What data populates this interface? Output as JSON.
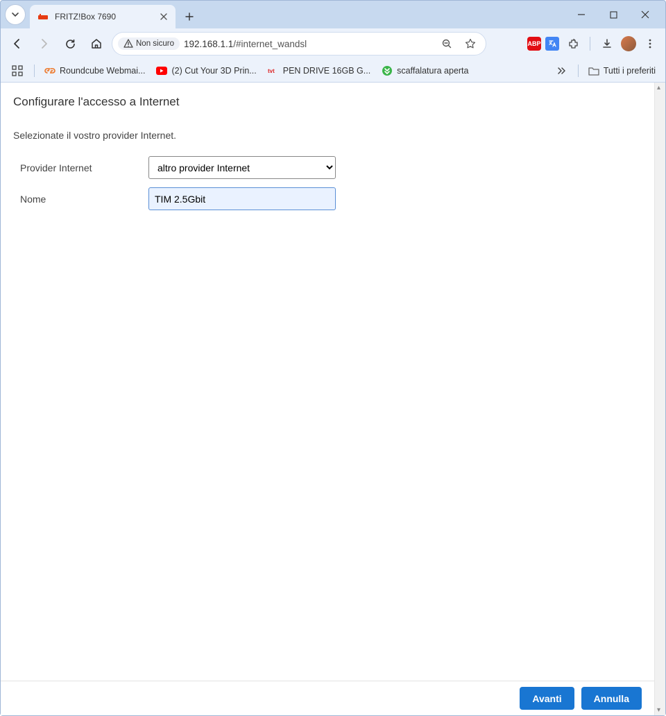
{
  "window": {
    "tab_title": "FRITZ!Box 7690"
  },
  "addressbar": {
    "security_label": "Non sicuro",
    "url_host": "192.168.1.1",
    "url_path": "/#internet_wandsl"
  },
  "bookmarks": {
    "items": [
      {
        "label": "Roundcube Webmai..."
      },
      {
        "label": "(2) Cut Your 3D Prin..."
      },
      {
        "label": "PEN DRIVE 16GB G..."
      },
      {
        "label": "scaffalatura aperta"
      }
    ],
    "all_label": "Tutti i preferiti"
  },
  "page": {
    "title": "Configurare l'accesso a Internet",
    "instruction": "Selezionate il vostro provider Internet.",
    "provider_label": "Provider Internet",
    "provider_value": "altro provider Internet",
    "name_label": "Nome",
    "name_value": "TIM 2.5Gbit"
  },
  "footer": {
    "next": "Avanti",
    "cancel": "Annulla"
  }
}
